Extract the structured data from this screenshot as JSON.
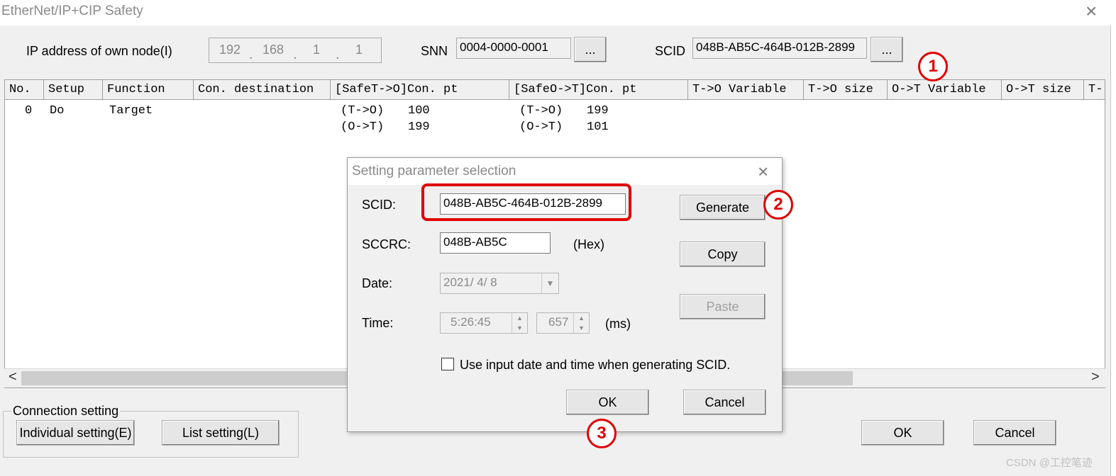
{
  "window": {
    "title": "EtherNet/IP+CIP Safety",
    "close": "×"
  },
  "node": {
    "ip_label": "IP address of own node(I)",
    "ip": [
      "192",
      "168",
      "1",
      "1"
    ],
    "ip_dot": ".",
    "snn_label": "SNN",
    "snn": "0004-0000-0001",
    "scid_label": "SCID",
    "scid": "048B-AB5C-464B-012B-2899",
    "browse": "..."
  },
  "table": {
    "columns": [
      "No.",
      "Setup",
      "Function",
      "Con. destination",
      "[SafeT->O]Con. pt",
      "[SafeO->T]Con. pt",
      "T->O Variable",
      "T->O size",
      "O->T Variable",
      "O->T size",
      "T-"
    ],
    "row": {
      "no": "0",
      "setup": "Do",
      "function": "Target",
      "t2o_a": "(T->O)",
      "t2o_a_val": "100",
      "t2o_b": "(O->T)",
      "t2o_b_val": "199",
      "o2t_a": "(T->O)",
      "o2t_a_val": "199",
      "o2t_b": "(O->T)",
      "o2t_b_val": "101"
    },
    "scroll_left": "<",
    "scroll_right": ">"
  },
  "connection": {
    "group_label": "Connection setting",
    "individual": "Individual setting(E)",
    "list": "List setting(L)"
  },
  "main_buttons": {
    "ok": "OK",
    "cancel": "Cancel"
  },
  "dialog": {
    "title": "Setting parameter selection",
    "close": "×",
    "scid_label": "SCID:",
    "scid": "048B-AB5C-464B-012B-2899",
    "sccrc_label": "SCCRC:",
    "sccrc": "048B-AB5C",
    "hex": "(Hex)",
    "date_label": "Date:",
    "date": "2021/ 4/ 8",
    "time_label": "Time:",
    "time": "5:26:45",
    "ms_value": "657",
    "ms": "(ms)",
    "checkbox_label": "Use input date and time when generating SCID.",
    "generate": "Generate",
    "copy": "Copy",
    "paste": "Paste",
    "ok": "OK",
    "cancel": "Cancel"
  },
  "callouts": [
    "1",
    "2",
    "3"
  ],
  "accent_color": "#e00000",
  "watermark": "CSDN @工控笔迹"
}
